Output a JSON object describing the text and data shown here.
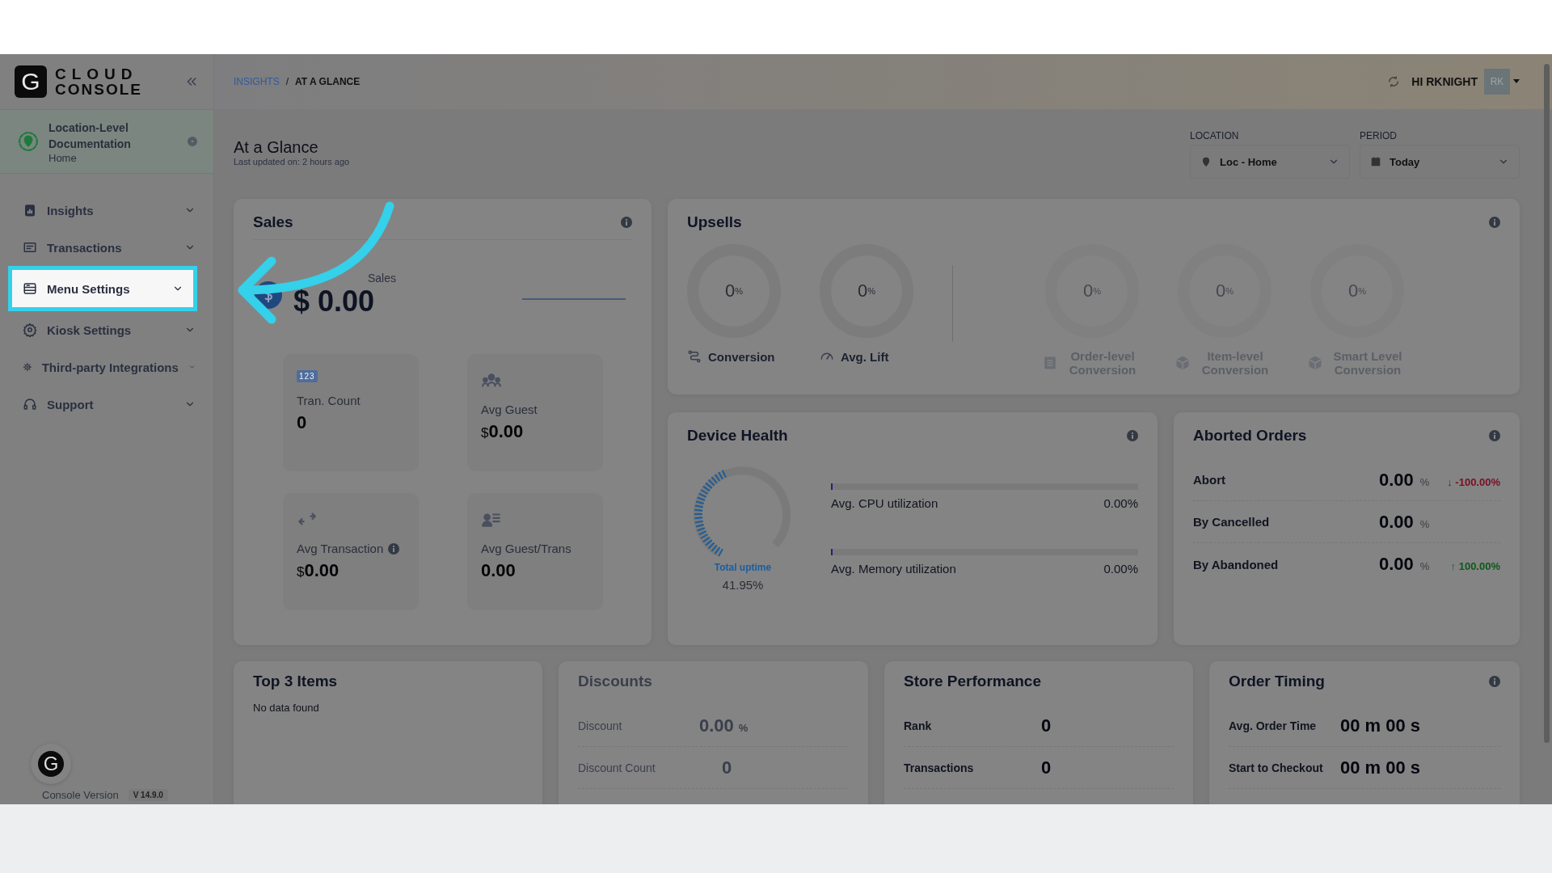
{
  "brand": {
    "logo_letter": "G",
    "name_line1": "CLOUD",
    "name_line2": "CONSOLE"
  },
  "location_card": {
    "name": "Location-Level Documentation",
    "sub": "Home"
  },
  "sidebar": {
    "items": [
      {
        "label": "Insights",
        "selected": false
      },
      {
        "label": "Transactions",
        "selected": false
      },
      {
        "label": "Menu Settings",
        "selected": true
      },
      {
        "label": "Kiosk Settings",
        "selected": false
      },
      {
        "label": "Third-party Integrations",
        "selected": false
      },
      {
        "label": "Support",
        "selected": false
      }
    ]
  },
  "console": {
    "logo_letter": "G",
    "version_label": "Console Version",
    "version": "V 14.9.0"
  },
  "breadcrumb": [
    {
      "label": "INSIGHTS",
      "kind": "link"
    },
    {
      "label": "/",
      "kind": "separator"
    },
    {
      "label": "AT A GLANCE",
      "kind": "current"
    }
  ],
  "user": {
    "greeting": "HI RKNIGHT",
    "initials": "RK"
  },
  "page": {
    "title": "At a Glance",
    "updated": "Last updated on: 2 hours ago"
  },
  "filters": [
    {
      "label": "LOCATION",
      "value": "Loc - Home"
    },
    {
      "label": "PERIOD",
      "value": "Today"
    }
  ],
  "sales": {
    "title": "Sales",
    "info": true,
    "total_label": "Sales",
    "total": "$ 0.00",
    "tiles": [
      {
        "badge": "123",
        "label": "Tran. Count",
        "value": "0",
        "info": false
      },
      {
        "label": "Avg Guest",
        "currency": "$",
        "value": "0.00",
        "info": false
      },
      {
        "label": "Avg Transaction",
        "currency": "$",
        "value": "0.00",
        "info": true
      },
      {
        "label": "Avg Guest/Trans",
        "value": "0.00",
        "info": false
      }
    ]
  },
  "upsells": {
    "title": "Upsells",
    "info": true,
    "metrics": [
      {
        "value": "0",
        "unit": "%",
        "label": "Conversion",
        "disabled": false
      },
      {
        "value": "0",
        "unit": "%",
        "label": "Avg. Lift",
        "disabled": false
      },
      {
        "value": "0",
        "unit": "%",
        "label": "Order-level Conversion",
        "disabled": true
      },
      {
        "value": "0",
        "unit": "%",
        "label": "Item-level Conversion",
        "disabled": true
      },
      {
        "value": "0",
        "unit": "%",
        "label": "Smart Level Conversion",
        "disabled": true
      }
    ]
  },
  "device_health": {
    "title": "Device Health",
    "info": true,
    "uptime_label": "Total uptime",
    "uptime": "41.95%",
    "bars": [
      {
        "label": "Avg. CPU utilization",
        "value": "0.00%",
        "level": 0
      },
      {
        "label": "Avg. Memory utilization",
        "value": "0.00%",
        "level": 0
      }
    ]
  },
  "aborted_orders": {
    "title": "Aborted Orders",
    "info": true,
    "rows": [
      {
        "label": "Abort",
        "value": "0.00",
        "unit": "%",
        "change": "↓ -100.00%",
        "kind": "down"
      },
      {
        "label": "By Cancelled",
        "value": "0.00",
        "unit": "%"
      },
      {
        "label": "By Abandoned",
        "value": "0.00",
        "unit": "%",
        "change": "↑ 100.00%",
        "kind": "up"
      }
    ]
  },
  "top_items": {
    "title": "Top 3 Items",
    "info": false,
    "empty": "No data found"
  },
  "discounts": {
    "title": "Discounts",
    "info": false,
    "disabled": true,
    "rows": [
      {
        "label": "Discount",
        "value": "0.00",
        "unit": "%"
      },
      {
        "label": "Discount Count",
        "value": "0"
      }
    ]
  },
  "store_performance": {
    "title": "Store Performance",
    "info": false,
    "rows": [
      {
        "label": "Rank",
        "value": "0"
      },
      {
        "label": "Transactions",
        "value": "0"
      }
    ]
  },
  "order_timing": {
    "title": "Order Timing",
    "info": true,
    "rows": [
      {
        "label": "Avg. Order Time",
        "value": "00 m 00 s"
      },
      {
        "label": "Start to Checkout",
        "value": "00 m 00 s"
      }
    ]
  }
}
